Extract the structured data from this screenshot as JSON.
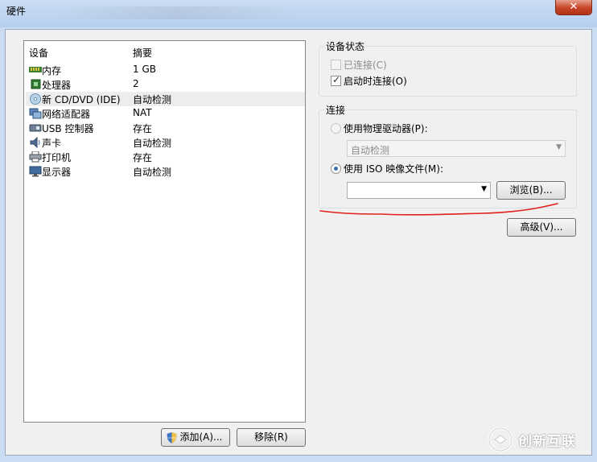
{
  "window": {
    "title": "硬件",
    "close_glyph": "✕"
  },
  "device_list": {
    "columns": [
      "设备",
      "摘要"
    ],
    "rows": [
      {
        "name": "内存",
        "summary": "1 GB",
        "icon": "memory-icon"
      },
      {
        "name": "处理器",
        "summary": "2",
        "icon": "processor-icon"
      },
      {
        "name": "新 CD/DVD (IDE)",
        "summary": "自动检测",
        "icon": "cd-dvd-icon"
      },
      {
        "name": "网络适配器",
        "summary": "NAT",
        "icon": "network-adapter-icon"
      },
      {
        "name": "USB 控制器",
        "summary": "存在",
        "icon": "usb-icon"
      },
      {
        "name": "声卡",
        "summary": "自动检测",
        "icon": "sound-card-icon"
      },
      {
        "name": "打印机",
        "summary": "存在",
        "icon": "printer-icon"
      },
      {
        "name": "显示器",
        "summary": "自动检测",
        "icon": "display-icon"
      }
    ],
    "selected_index": 2
  },
  "buttons": {
    "add": "添加(A)...",
    "remove": "移除(R)",
    "browse": "浏览(B)...",
    "advanced": "高级(V)..."
  },
  "device_status": {
    "legend": "设备状态",
    "connected_label": "已连接(C)",
    "connected_checked": false,
    "connected_enabled": false,
    "connect_at_power_on_label": "启动时连接(O)",
    "connect_at_power_on_checked": true
  },
  "connection": {
    "legend": "连接",
    "physical_drive_label": "使用物理驱动器(P):",
    "physical_drive_selected": false,
    "physical_drive_value": "自动检测",
    "iso_label": "使用 ISO 映像文件(M):",
    "iso_selected": true,
    "iso_value": ""
  },
  "annotation": {
    "color": "#e0201a"
  },
  "watermark": {
    "text": "创新互联"
  }
}
